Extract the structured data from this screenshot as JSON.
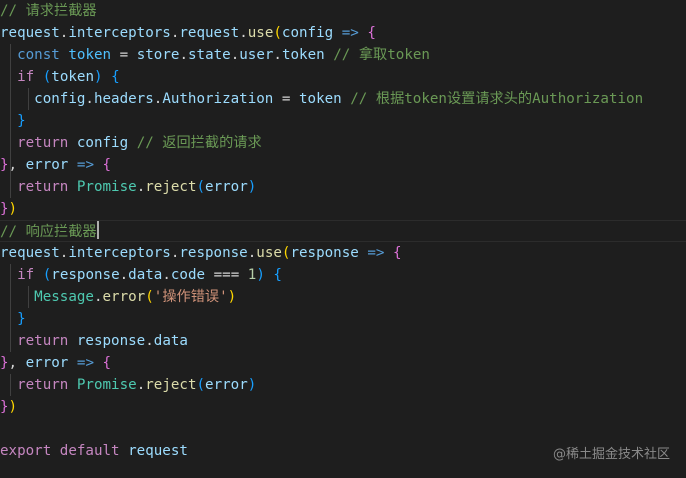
{
  "code": {
    "comment_request": "// 请求拦截器",
    "request_obj": "request",
    "interceptors": "interceptors",
    "request_prop": "request",
    "use": "use",
    "config": "config",
    "arrow": "=>",
    "const_kw": "const",
    "token_var": "token",
    "store": "store",
    "state": "state",
    "user": "user",
    "token_prop": "token",
    "comment_token": "// 拿取token",
    "if_kw": "if",
    "headers": "headers",
    "authorization": "Authorization",
    "comment_auth": "// 根据token设置请求头的Authorization",
    "return_kw": "return",
    "comment_return_req": "// 返回拦截的请求",
    "error": "error",
    "promise": "Promise",
    "reject": "reject",
    "comment_response": "// 响应拦截器",
    "response_prop": "response",
    "response_var": "response",
    "data": "data",
    "code_prop": "code",
    "strict_eq": "===",
    "one": "1",
    "message": "Message",
    "error_fn": "error",
    "err_msg": "'操作错误'",
    "export_kw": "export",
    "default_kw": "default",
    "request_export": "request"
  },
  "watermark": "@稀土掘金技术社区"
}
